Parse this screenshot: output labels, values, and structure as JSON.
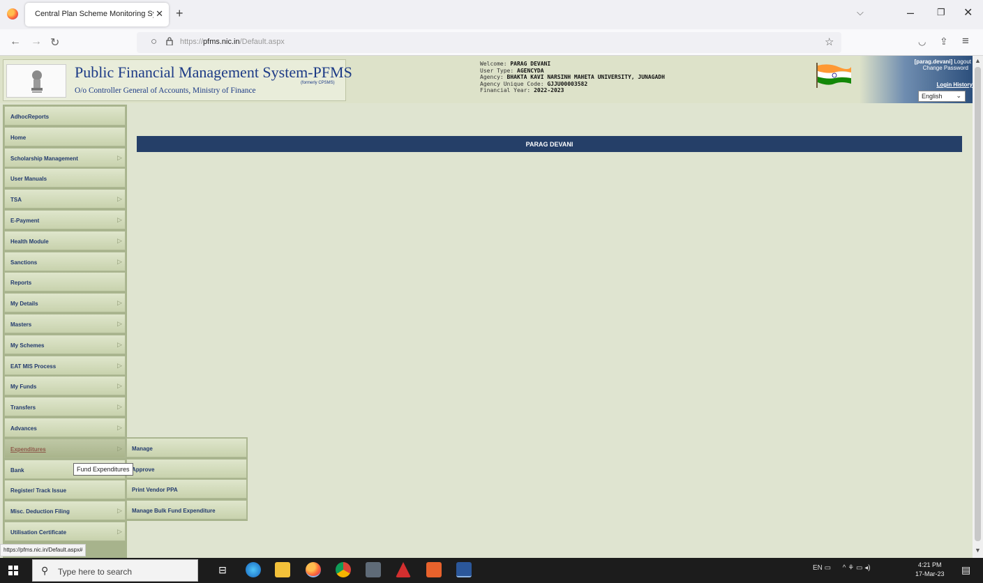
{
  "browser": {
    "tab_title": "Central Plan Scheme Monitoring Sy",
    "tab_close": "✕",
    "new_tab": "+",
    "url_prefix": "https://",
    "url_domain": "pfms.nic.in",
    "url_path": "/Default.aspx"
  },
  "header": {
    "title": "Public Financial Management System-PFMS",
    "subtitle": "O/o Controller General of Accounts, Ministry of Finance",
    "former": "(formerly CPSMS)",
    "welcome_label": "Welcome:",
    "welcome_value": "PARAG DEVANI",
    "user_type_label": "User Type:",
    "user_type_value": "AGENCYDA",
    "agency_label": "Agency:",
    "agency_value": "BHAKTA KAVI NARSINH MAHETA UNIVERSITY, JUNAGADH",
    "agency_code_label": "Agency Unique Code:",
    "agency_code_value": "GJJU00003582",
    "fin_year_label": "Financial Year:",
    "fin_year_value": "2022-2023",
    "user_id": "[parag.devani]",
    "logout": "Logout",
    "change_password": "Change Password",
    "login_history": "Login History",
    "language": "English"
  },
  "sidebar": {
    "items": [
      {
        "label": "AdhocReports",
        "arrow": ""
      },
      {
        "label": "Home",
        "arrow": ""
      },
      {
        "label": "Scholarship Management",
        "arrow": "▷"
      },
      {
        "label": "User Manuals",
        "arrow": ""
      },
      {
        "label": "TSA",
        "arrow": "▷"
      },
      {
        "label": "E-Payment",
        "arrow": "▷"
      },
      {
        "label": "Health Module",
        "arrow": "▷"
      },
      {
        "label": "Sanctions",
        "arrow": "▷"
      },
      {
        "label": "Reports",
        "arrow": ""
      },
      {
        "label": "My Details",
        "arrow": "▷"
      },
      {
        "label": "Masters",
        "arrow": "▷"
      },
      {
        "label": "My Schemes",
        "arrow": "▷"
      },
      {
        "label": "EAT MIS Process",
        "arrow": "▷"
      },
      {
        "label": "My Funds",
        "arrow": "▷"
      },
      {
        "label": "Transfers",
        "arrow": "▷"
      },
      {
        "label": "Advances",
        "arrow": "▷"
      },
      {
        "label": "Expenditures",
        "arrow": "▷"
      },
      {
        "label": "Bank",
        "arrow": ""
      },
      {
        "label": "Register/ Track Issue",
        "arrow": ""
      },
      {
        "label": "Misc. Deduction Filing",
        "arrow": "▷"
      },
      {
        "label": "Utilisation Certificate",
        "arrow": "▷"
      }
    ]
  },
  "submenu": {
    "items": [
      "Manage",
      "Approve",
      "Print Vendor PPA",
      "Manage Bulk Fund Expenditure"
    ]
  },
  "tooltip": "Fund Expenditures",
  "banner": "PARAG DEVANI",
  "status_url": "https://pfms.nic.in/Default.aspx#",
  "taskbar": {
    "search_placeholder": "Type here to search",
    "tray_lang": "EN",
    "time": "4:21 PM",
    "date": "17-Mar-23"
  }
}
